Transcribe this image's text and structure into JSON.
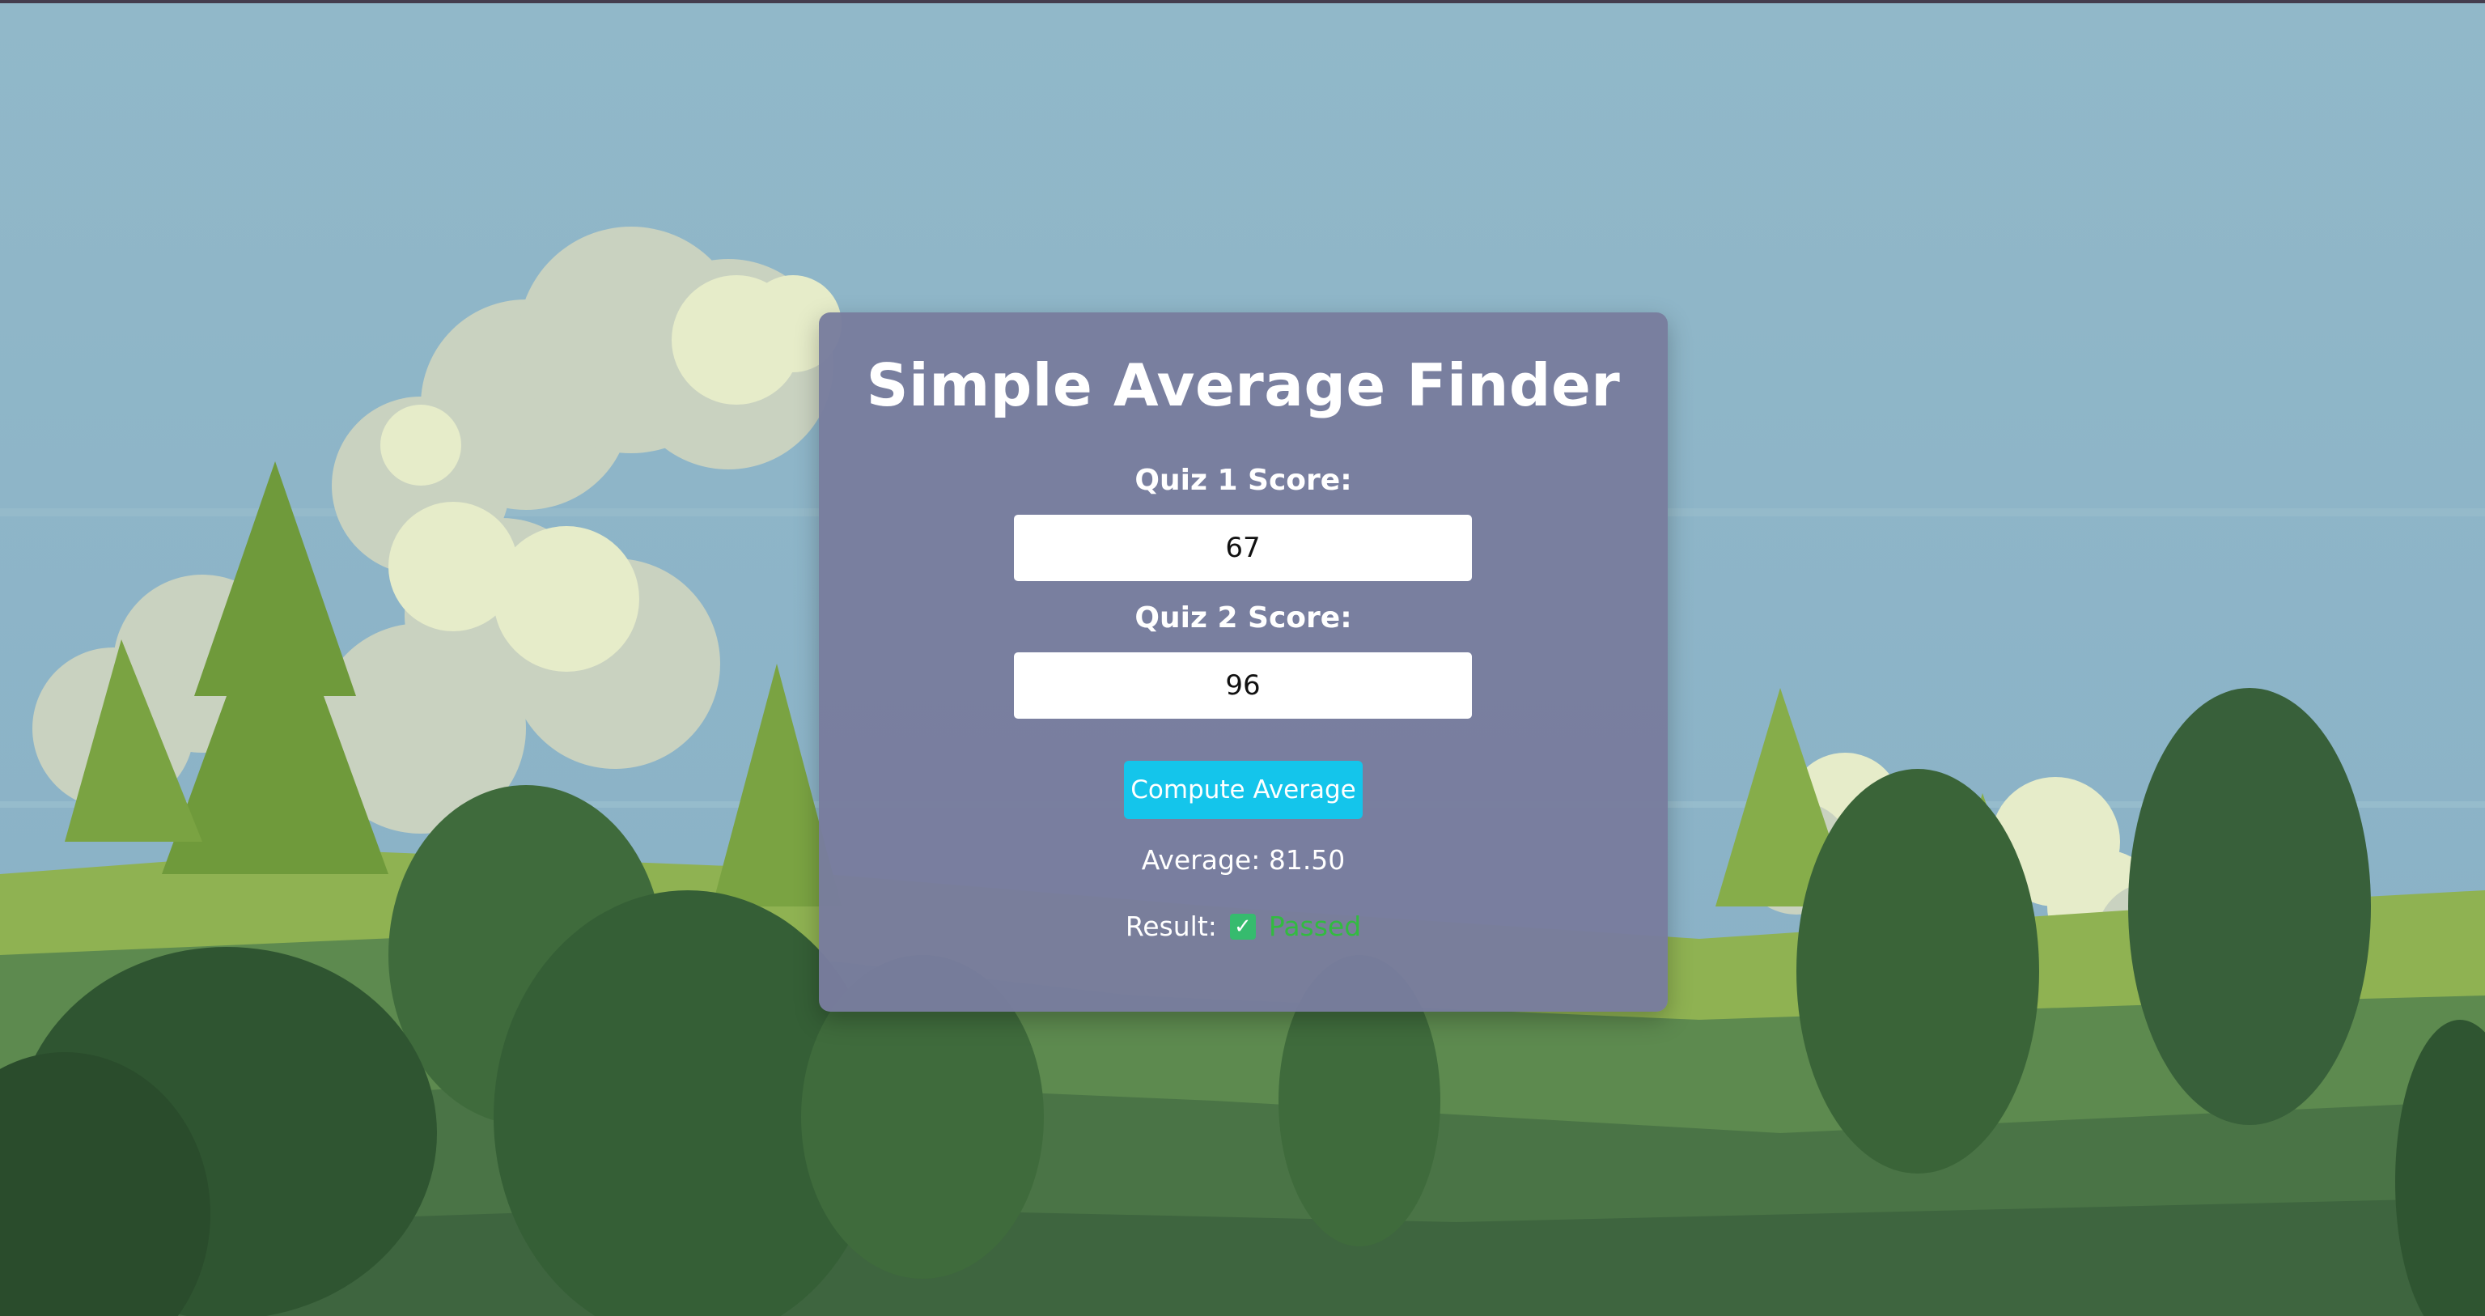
{
  "app": {
    "title": "Simple Average Finder"
  },
  "form": {
    "quiz1": {
      "label": "Quiz 1 Score:",
      "value": "67"
    },
    "quiz2": {
      "label": "Quiz 2 Score:",
      "value": "96"
    },
    "compute_label": "Compute Average"
  },
  "output": {
    "average_text": "Average: 81.50",
    "result_label": "Result:",
    "result_icon": "check-mark-icon",
    "result_value": "Passed"
  },
  "colors": {
    "card_background": "#787c9e",
    "button": "#14c5eb",
    "passed_text": "#32bb40",
    "check_badge": "#36bb6e"
  }
}
